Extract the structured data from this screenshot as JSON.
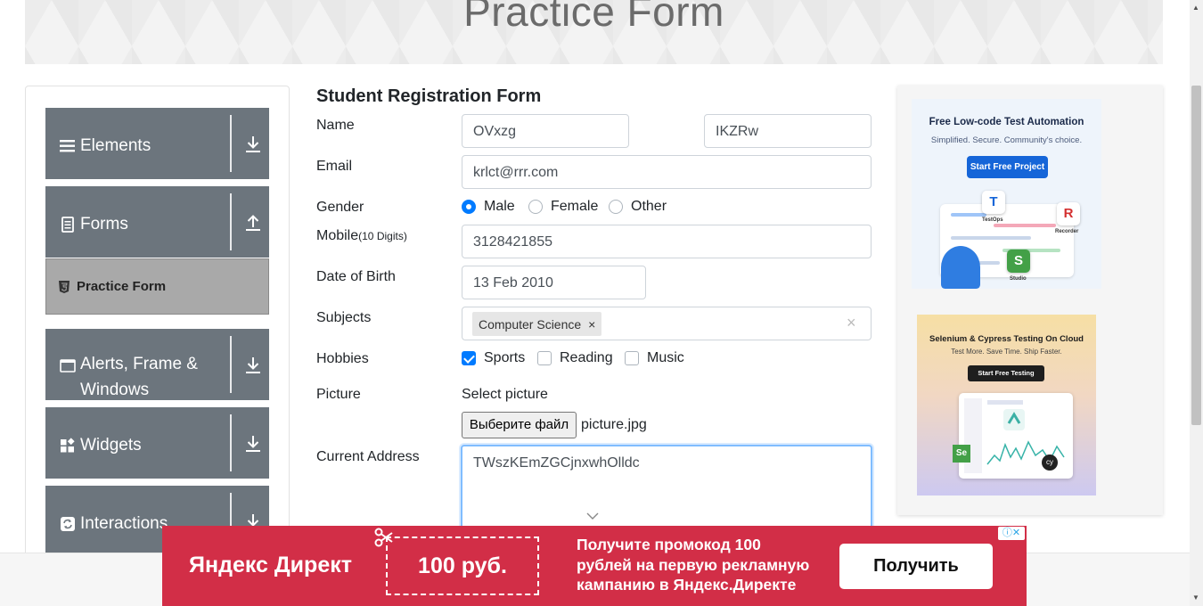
{
  "header": {
    "title": "Practice Form"
  },
  "sidebar": {
    "groups": [
      {
        "label": "Elements",
        "icon": "hamburger-icon",
        "arrow": "download-icon"
      },
      {
        "label": "Forms",
        "icon": "document-icon",
        "arrow": "upload-icon"
      },
      {
        "label": "Alerts, Frame & Windows",
        "icon": "window-icon",
        "arrow": "download-icon"
      },
      {
        "label": "Widgets",
        "icon": "widgets-icon",
        "arrow": "download-icon"
      },
      {
        "label": "Interactions",
        "icon": "interactions-icon",
        "arrow": "download-icon"
      }
    ],
    "active_item": {
      "label": "Practice Form",
      "icon": "html5-icon"
    }
  },
  "form": {
    "title": "Student Registration Form",
    "name_label": "Name",
    "first_name": "OVxzg",
    "last_name": "IKZRw",
    "email_label": "Email",
    "email": "krlct@rrr.com",
    "gender_label": "Gender",
    "genders": [
      "Male",
      "Female",
      "Other"
    ],
    "gender_selected": "Male",
    "mobile_label": "Mobile",
    "mobile_hint": "(10 Digits)",
    "mobile": "3128421855",
    "dob_label": "Date of Birth",
    "dob": "13 Feb 2010",
    "subjects_label": "Subjects",
    "subject_chip": "Computer Science",
    "chip_remove": "×",
    "clear_all": "×",
    "hobbies_label": "Hobbies",
    "hobbies": [
      "Sports",
      "Reading",
      "Music"
    ],
    "hobbies_checked": [
      "Sports"
    ],
    "picture_label": "Picture",
    "select_picture": "Select picture",
    "file_button": "Выберите файл",
    "file_name": "picture.jpg",
    "address_label": "Current Address",
    "address": "TWszKEmZGCjnxwhOlldc"
  },
  "ads": {
    "katalon": {
      "title": "Free Low-code Test Automation",
      "subtitle": "Simplified. Secure. Community's choice.",
      "button": "Start Free Project",
      "products": [
        "TestOps",
        "Recorder",
        "Studio"
      ]
    },
    "lambdatest": {
      "title": "Selenium & Cypress Testing On Cloud",
      "subtitle": "Test More. Save Time. Ship Faster.",
      "button": "Start Free Testing"
    },
    "yandex": {
      "brand": "Яндекс Директ",
      "coupon": "100 руб.",
      "message_1": "Получите промокод 100",
      "message_2": "рублей на первую рекламную",
      "message_3": "кампанию в Яндекс.Директе",
      "cta": "Получить",
      "adinfo": "ⓘ✕"
    }
  },
  "colors": {
    "sidebar_group_bg": "#6c757d",
    "sidebar_active_bg": "#a9a9a9",
    "accent": "#007bff",
    "yandex_red": "#d22e47"
  }
}
